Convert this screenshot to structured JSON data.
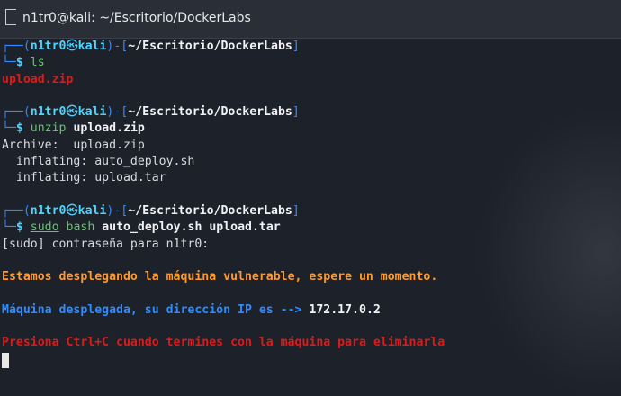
{
  "window": {
    "title": "n1tr0@kali: ~/Escritorio/DockerLabs"
  },
  "prompt": {
    "top_left": "┌──(",
    "user": "n1tr0",
    "sep": "㉿",
    "host": "kali",
    "mid": ")-[",
    "path": "~/Escritorio/DockerLabs",
    "end": "]",
    "bottom": "└─",
    "dollar": "$"
  },
  "commands": [
    {
      "cmd": "ls",
      "args": ""
    },
    {
      "cmd": "unzip",
      "args": "upload.zip"
    },
    {
      "cmd": "sudo",
      "cmd2": "bash",
      "args": "auto_deploy.sh upload.tar"
    }
  ],
  "output": {
    "ls_result": "upload.zip",
    "archive": "Archive:  upload.zip",
    "inflate1": "  inflating: auto_deploy.sh",
    "inflate2": "  inflating: upload.tar",
    "sudo_prompt": "[sudo] contraseña para n1tr0:",
    "deploying": "Estamos desplegando la máquina vulnerable, espere un momento.",
    "deployed_label": "Máquina desplegada, su dirección IP es -->",
    "ip": "172.17.0.2",
    "press": "Presiona Ctrl+C cuando termines con la máquina para eliminarla"
  },
  "colors": {
    "prompt_frame": "#2f8cff",
    "user_host": "#4dd5ff",
    "error_file": "#e01919",
    "warn": "#ff9a2e",
    "info": "#2f8cff"
  },
  "icons": [
    "terminal-icon"
  ]
}
